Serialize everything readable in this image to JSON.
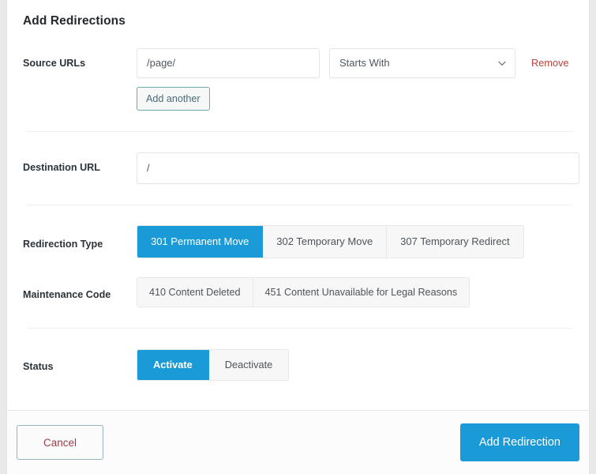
{
  "panel": {
    "title": "Add Redirections"
  },
  "source": {
    "label": "Source URLs",
    "url_value": "/page/",
    "url_placeholder": "/page/",
    "match_selected": "Starts With",
    "match_options": [
      "Starts With"
    ],
    "remove_label": "Remove",
    "add_another_label": "Add another",
    "chevron_icon": "chevron-down-icon"
  },
  "destination": {
    "label": "Destination URL",
    "value": "/",
    "placeholder": "/"
  },
  "redirection_type": {
    "label": "Redirection Type",
    "options": [
      {
        "label": "301 Permanent Move",
        "active": true
      },
      {
        "label": "302 Temporary Move",
        "active": false
      },
      {
        "label": "307 Temporary Redirect",
        "active": false
      }
    ]
  },
  "maintenance_code": {
    "label": "Maintenance Code",
    "options": [
      {
        "label": "410 Content Deleted",
        "active": false
      },
      {
        "label": "451 Content Unavailable for Legal Reasons",
        "active": false
      }
    ]
  },
  "status": {
    "label": "Status",
    "options": [
      {
        "label": "Activate",
        "active": true
      },
      {
        "label": "Deactivate",
        "active": false
      }
    ]
  },
  "footer": {
    "cancel_label": "Cancel",
    "submit_label": "Add Redirection"
  },
  "colors": {
    "accent_blue": "#1a9bd7",
    "remove_red": "#b5413b",
    "cancel_red": "#9b3d46",
    "secondary_border": "#6fa8b5",
    "divider": "#f0f0f1"
  }
}
